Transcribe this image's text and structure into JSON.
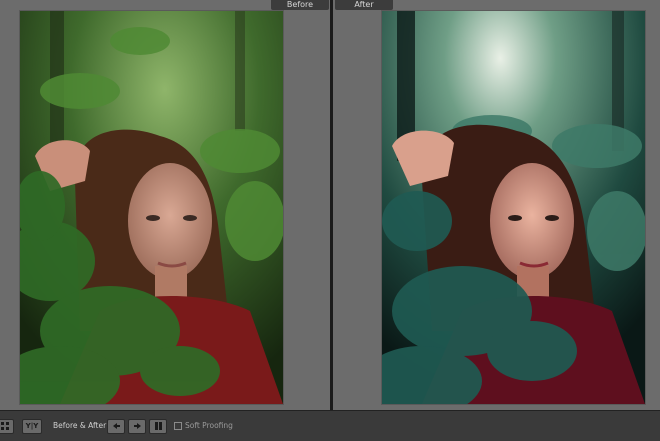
{
  "compare": {
    "before_label": "Before",
    "after_label": "After"
  },
  "toolbar": {
    "view_mode_yy": "Y|Y",
    "before_after_label": "Before & After :",
    "soft_proofing_label": "Soft Proofing",
    "soft_proofing_checked": false
  },
  "icons": {
    "grid": "grid-icon",
    "copy_left": "copy-before-to-after-icon",
    "copy_right": "copy-after-to-before-icon",
    "swap": "swap-icon"
  },
  "colors": {
    "panel_bg": "#6c6c6c",
    "toolbar_bg": "#3a3a3a",
    "sweater_before": "#7a1a1a",
    "sweater_after": "#5e0f1e"
  }
}
